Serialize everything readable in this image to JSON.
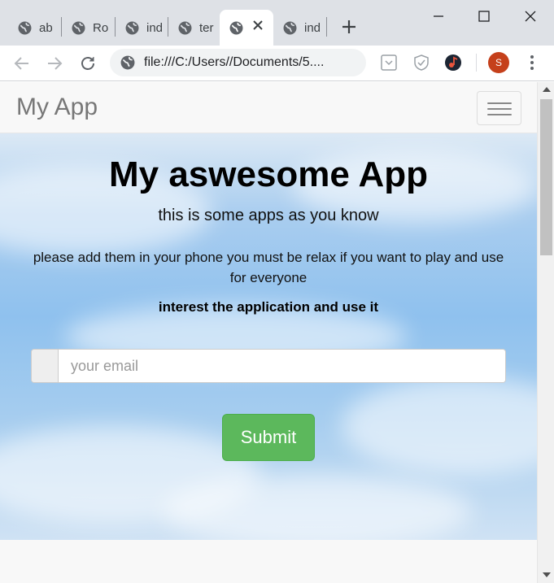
{
  "browser": {
    "tabs": [
      {
        "title": "ab",
        "active": false
      },
      {
        "title": "Ro",
        "active": false
      },
      {
        "title": "ind",
        "active": false
      },
      {
        "title": "ter",
        "active": false
      },
      {
        "title": "",
        "active": true
      },
      {
        "title": "ind",
        "active": false
      }
    ],
    "address": "file:///C:/Users//Documents/5....",
    "profile_initial": "S",
    "colors": {
      "tab_strip": "#dee1e6",
      "avatar": "#c5401b"
    }
  },
  "page": {
    "brand": "My App",
    "hero": {
      "title": "My aswesome App",
      "subtitle": "this is some apps as you know",
      "description": "please add them in your phone you must be relax if you want to play and use for everyone",
      "emphasis": "interest the application and use it"
    },
    "form": {
      "email_placeholder": "your email",
      "email_value": "",
      "submit_label": "Submit"
    },
    "colors": {
      "navbar": "#f8f8f8",
      "brand_text": "#777777",
      "submit": "#5cb85c"
    }
  }
}
